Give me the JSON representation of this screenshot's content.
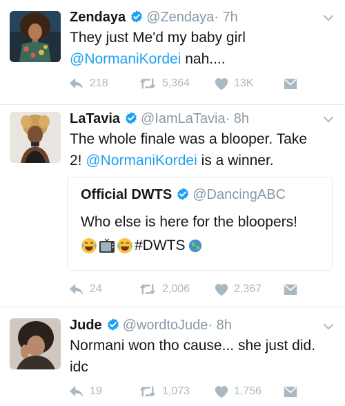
{
  "tweets": [
    {
      "name": "Zendaya",
      "handle": "@Zendaya",
      "time": "· 7h",
      "text_line1": "They just Me'd my baby girl",
      "mention": "@NormaniKordei",
      "text_after_mention": " nah....",
      "replies": "218",
      "retweets": "5,364",
      "likes": "13K"
    },
    {
      "name": "LaTavia",
      "handle": "@IamLaTavia",
      "time": "· 8h",
      "text_line1": "The whole finale was a blooper. Take",
      "text_line2_before": "2! ",
      "mention": "@NormaniKordei",
      "text_after_mention": " is a winner.",
      "quote": {
        "name": "Official DWTS",
        "handle": "@DancingABC",
        "text": "Who else is here for the bloopers!",
        "hashtag": "#DWTS"
      },
      "replies": "24",
      "retweets": "2,006",
      "likes": "2,367"
    },
    {
      "name": "Jude",
      "handle": "@wordtoJude",
      "time": "· 8h",
      "text_line1": "Normani won tho cause... she just did.",
      "text_line2": "idc",
      "replies": "19",
      "retweets": "1,073",
      "likes": "1,756"
    }
  ],
  "colors": {
    "accent": "#1da1f2",
    "muted": "#8899a6",
    "icon": "#aab8c2",
    "divider": "#e1e8ed"
  },
  "icons": [
    "reply-icon",
    "retweet-icon",
    "like-icon",
    "dm-icon",
    "verified-icon",
    "chevron-down-icon"
  ]
}
